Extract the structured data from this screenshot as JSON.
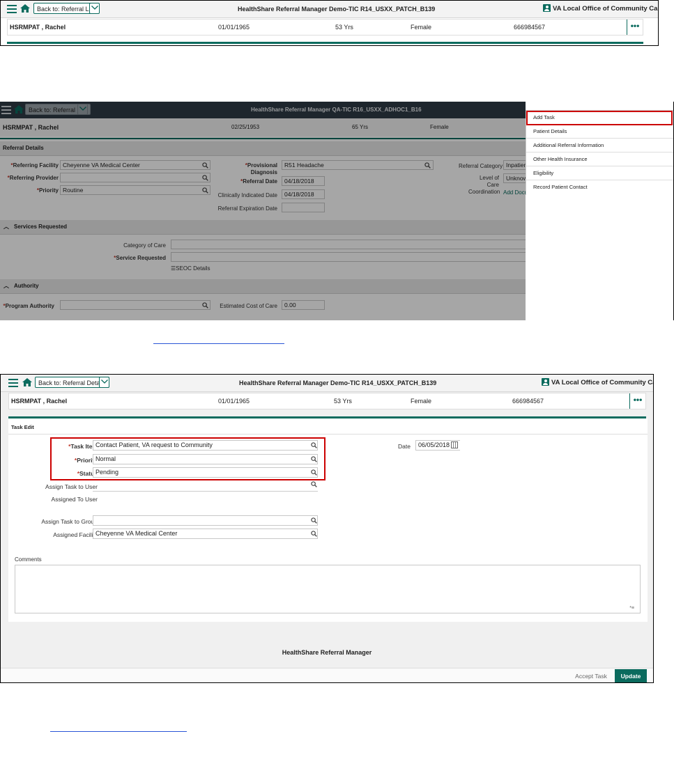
{
  "shot1": {
    "back_label": "Back to: Referral List",
    "app_title": "HealthShare Referral Manager Demo-TIC R14_USXX_PATCH_B139",
    "office": "VA Local Office of Community Care",
    "patient": {
      "name": "HSRMPAT , Rachel",
      "dob": "01/01/1965",
      "age": "53 Yrs",
      "sex": "Female",
      "id": "666984567"
    }
  },
  "shot2": {
    "back_label": "Back to: Referral List",
    "app_title": "HealthShare Referral Manager QA-TIC R16_USXX_ADHOC1_B16",
    "patient": {
      "name": "HSRMPAT , Rachel",
      "dob": "02/25/1953",
      "age": "65 Yrs",
      "sex": "Female"
    },
    "section_referral": "Referral Details",
    "section_services": "Services Requested",
    "section_authority": "Authority",
    "labels": {
      "referring_facility": "Referring Facility",
      "referring_provider": "Referring Provider",
      "priority": "Priority",
      "provisional_diagnosis": "Provisional Diagnosis",
      "referral_date": "Referral Date",
      "clinically_indicated_date": "Clinically Indicated Date",
      "referral_expiration_date": "Referral Expiration Date",
      "referral_category": "Referral Category",
      "level_of_care": "Level of Care Coordination",
      "add_docu": "Add Docu",
      "category_of_care": "Category of Care",
      "service_requested": "Service Requested",
      "seoc_details": "SEOC Details",
      "program_authority": "Program Authority",
      "estimated_cost": "Estimated Cost of Care"
    },
    "values": {
      "referring_facility": "Cheyenne VA Medical Center",
      "priority": "Routine",
      "provisional_diagnosis": "R51 Headache",
      "referral_date": "04/18/2018",
      "clinically_indicated_date": "04/18/2018",
      "referral_category": "Inpatient",
      "level_of_care": "Unknow",
      "estimated_cost": "0.00"
    },
    "menu": [
      "Add Task",
      "Patient Details",
      "Additional Referral Information",
      "Other Health Insurance",
      "Eligibility",
      "Record Patient Contact"
    ]
  },
  "shot3": {
    "back_label": "Back to: Referral Details",
    "app_title": "HealthShare Referral Manager Demo-TIC R14_USXX_PATCH_B139",
    "office": "VA Local Office of Community Care",
    "patient": {
      "name": "HSRMPAT , Rachel",
      "dob": "01/01/1965",
      "age": "53 Yrs",
      "sex": "Female",
      "id": "666984567"
    },
    "section_title": "Task Edit",
    "labels": {
      "task_item": "Task Item",
      "priority": "Priority",
      "status": "Status",
      "assign_task_to_user": "Assign Task to User",
      "assigned_to_user": "Assigned To User",
      "assign_task_to_group": "Assign Task to Group",
      "assigned_facility": "Assigned Facility",
      "date": "Date",
      "comments": "Comments"
    },
    "values": {
      "task_item": "Contact Patient, VA request to Community",
      "priority": "Normal",
      "status": "Pending",
      "assigned_facility": "Cheyenne VA Medical Center",
      "date": "06/05/2018"
    },
    "footer_title": "HealthShare Referral Manager",
    "accept_task": "Accept Task",
    "update": "Update"
  },
  "colors": {
    "accent": "#0b6b5e",
    "highlight": "#cc0000",
    "link": "#2a55d6"
  }
}
